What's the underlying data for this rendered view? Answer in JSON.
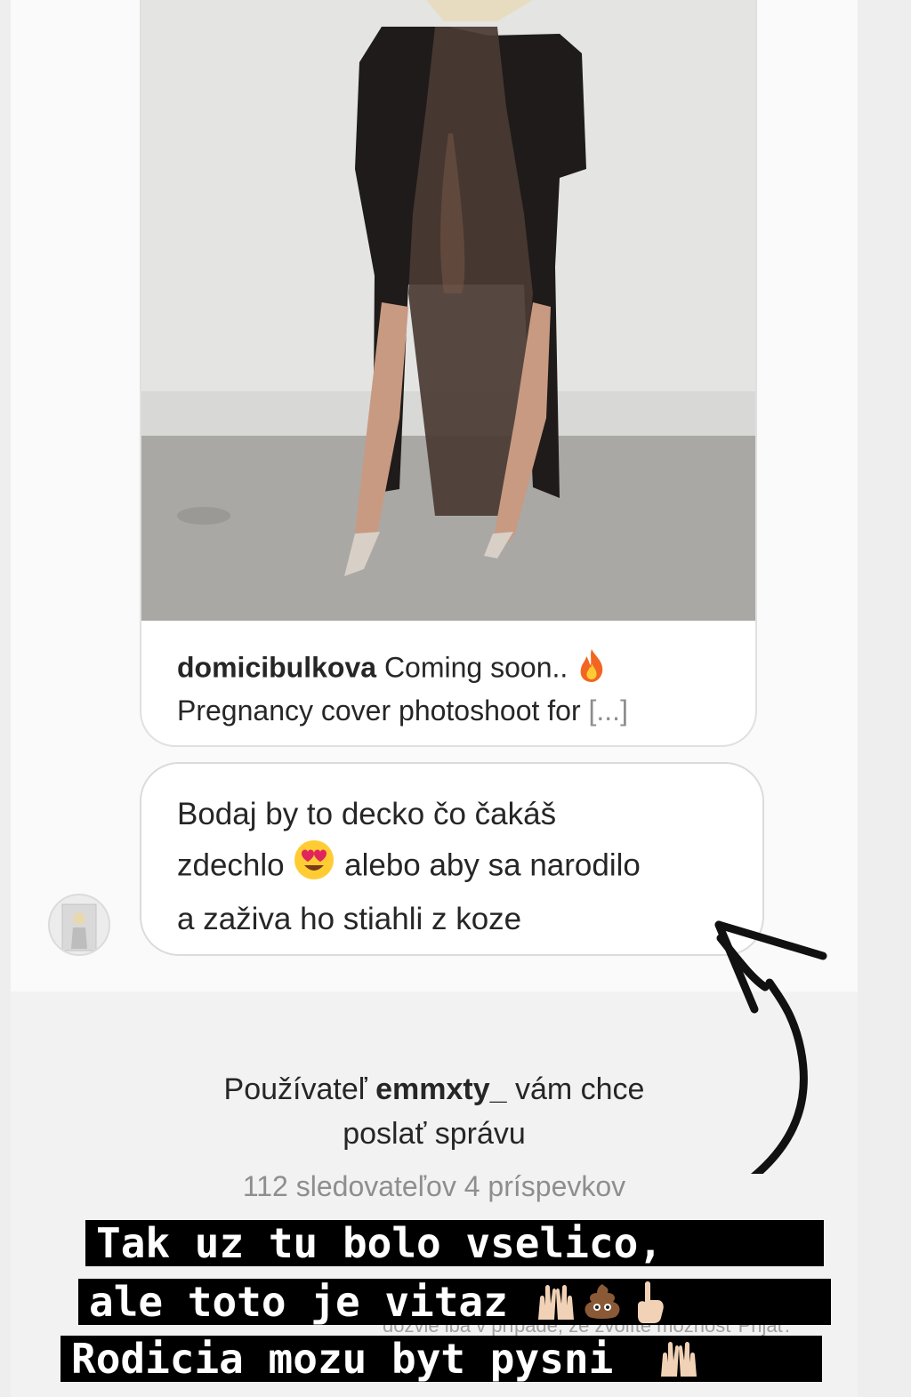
{
  "shared_post": {
    "username": "domicibulkova",
    "caption_line1": "Coming soon..",
    "caption_line2": "Pregnancy cover photoshoot for",
    "more": "[...]",
    "fire_emoji": "fire-icon"
  },
  "message": {
    "line1": "Bodaj by to decko čo čakáš",
    "line2_a": "zdechlo",
    "line2_b": "alebo aby sa narodilo",
    "line3": "a zaživa ho stiahli z koze",
    "emoji": "heart-eyes-icon"
  },
  "request": {
    "prefix": "Používateľ",
    "handle": "emmxty_",
    "suffix": "vám chce",
    "line2": "poslať správu",
    "stats": "112 sledovateľov 4 príspevkov",
    "faded_text": "dozvie iba v prípade, že zvolíte možnosť Prijať."
  },
  "overlay": {
    "line1": "Tak uz tu bolo vselico,",
    "line2": "ale toto je vitaz",
    "line3": "Rodicia mozu byt pysni"
  },
  "colors": {
    "accent_text": "#262626",
    "muted_text": "#8e8e8e",
    "overlay_bg": "#000000",
    "overlay_text": "#ffffff"
  }
}
